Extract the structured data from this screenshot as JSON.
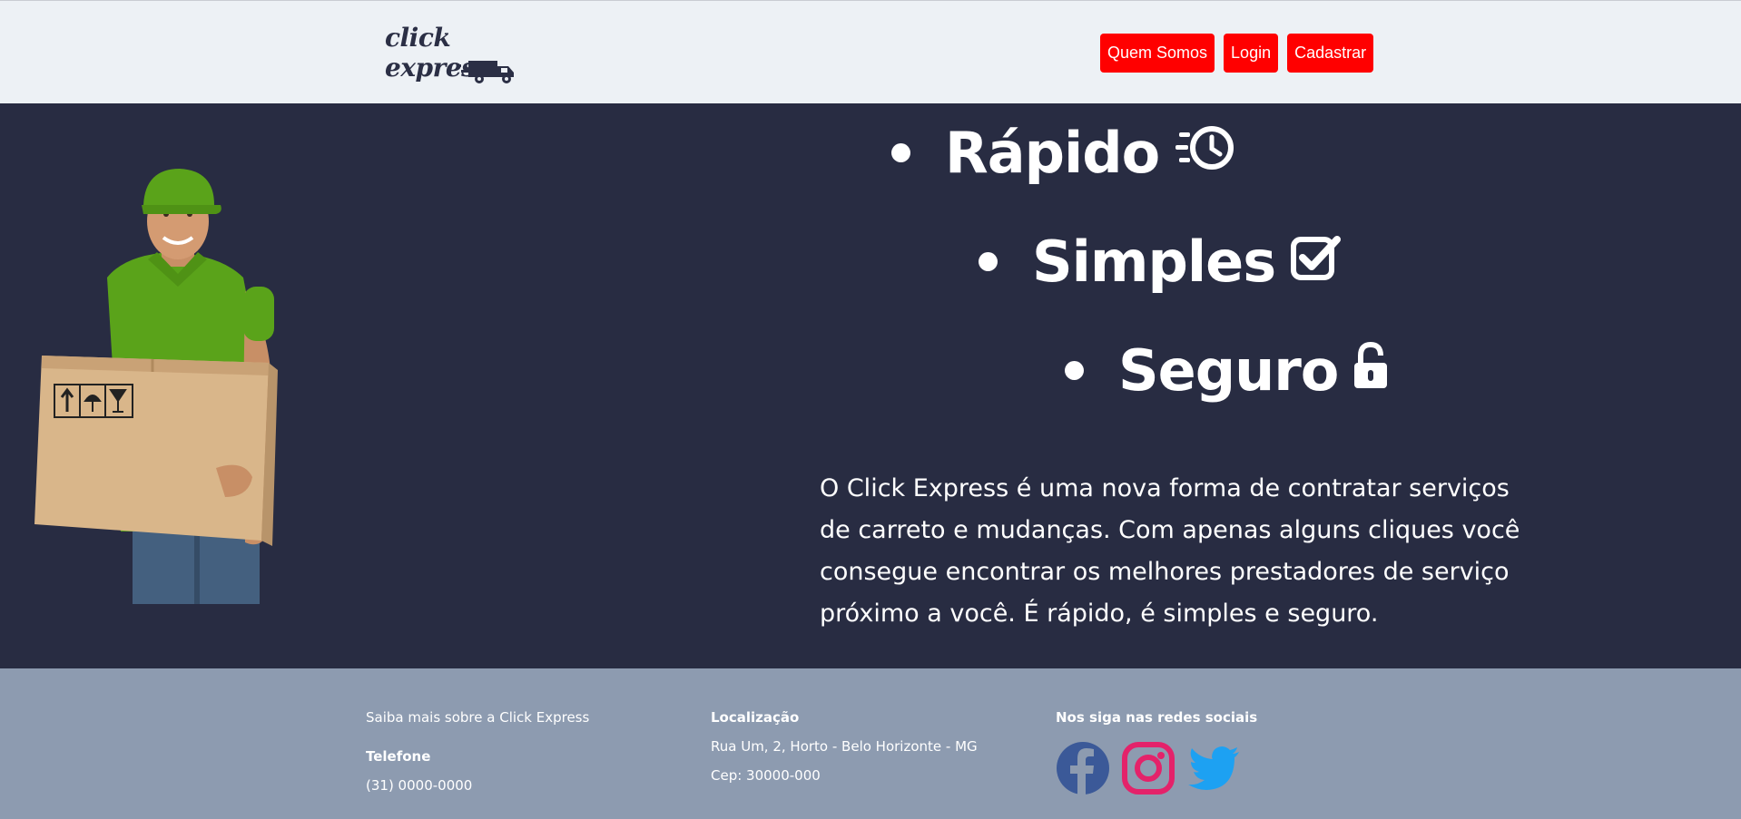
{
  "header": {
    "logo_text": "click express",
    "nav": [
      {
        "label": "Quem Somos"
      },
      {
        "label": "Login"
      },
      {
        "label": "Cadastrar"
      }
    ]
  },
  "hero": {
    "bullets": [
      {
        "label": "Rápido",
        "icon": "clock-fast-icon"
      },
      {
        "label": "Simples",
        "icon": "check-square-icon"
      },
      {
        "label": "Seguro",
        "icon": "lock-icon"
      }
    ],
    "description": "O Click Express é uma nova forma de contratar serviços de carreto e mudanças. Com apenas alguns cliques você consegue encontrar os melhores prestadores de serviço próximo a você. É rápido, é simples e seguro."
  },
  "footer": {
    "about": "Saiba mais sobre a Click Express",
    "phone_label": "Telefone",
    "phone": "(31) 0000-0000",
    "location_label": "Localização",
    "address": "Rua Um, 2, Horto - Belo Horizonte - MG",
    "cep": "Cep: 30000-000",
    "social_label": "Nos siga nas redes sociais",
    "social_icons": [
      "facebook-icon",
      "instagram-icon",
      "twitter-icon"
    ]
  },
  "colors": {
    "header_bg": "#edf1f5",
    "hero_bg": "#282c42",
    "footer_bg": "#8d9bb0",
    "button_red": "#ff0000",
    "facebook": "#3b5998",
    "instagram": "#e4226a",
    "twitter": "#1da1f2"
  }
}
